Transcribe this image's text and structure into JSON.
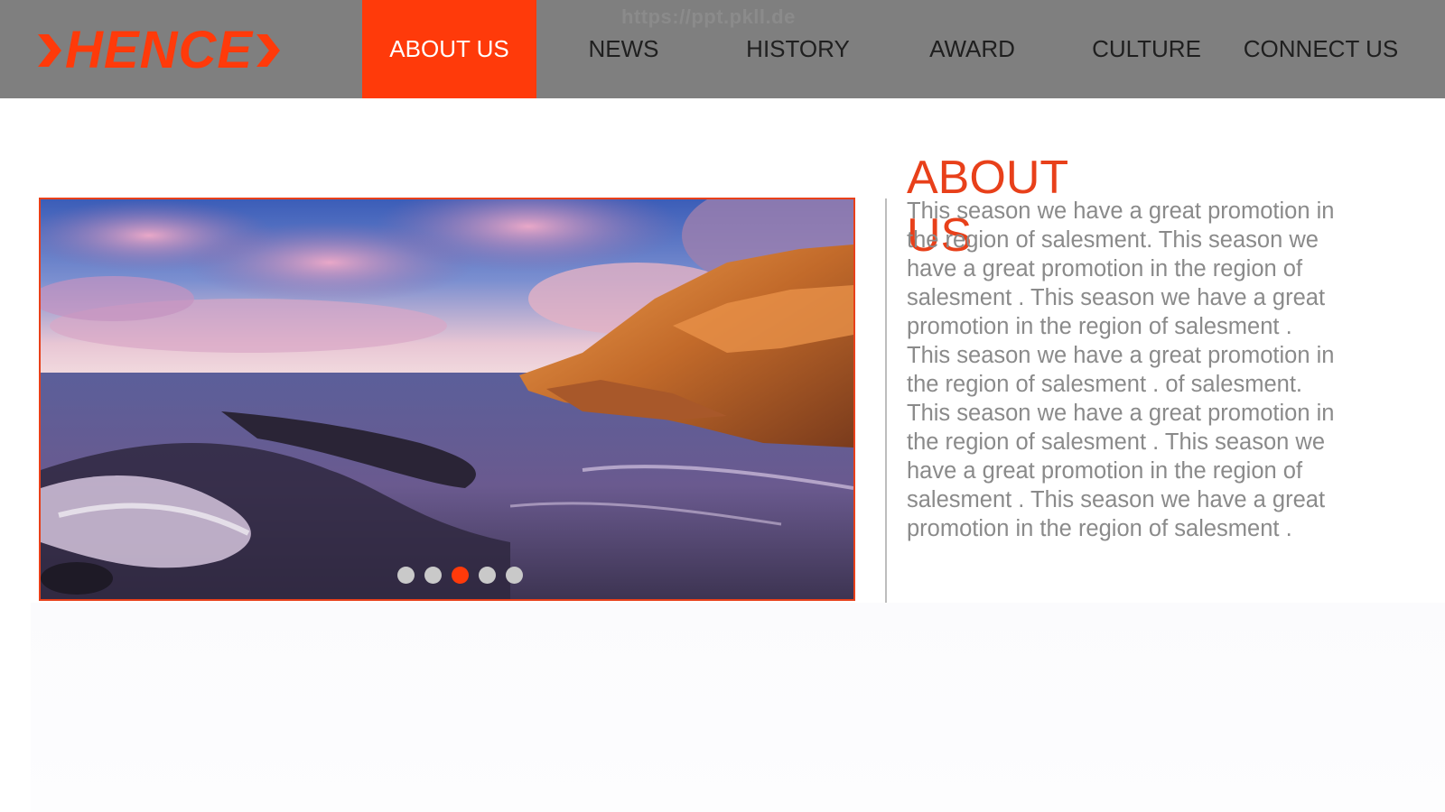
{
  "brand": {
    "name": "HENCE",
    "color": "#ff3a0a"
  },
  "watermark": "https://ppt.pkll.de",
  "nav": {
    "items": [
      {
        "label": "ABOUT US",
        "active": true
      },
      {
        "label": "NEWS",
        "active": false
      },
      {
        "label": "HISTORY",
        "active": false
      },
      {
        "label": "AWARD",
        "active": false
      },
      {
        "label": "CULTURE",
        "active": false
      },
      {
        "label": "CONNECT US",
        "active": false
      }
    ]
  },
  "slider": {
    "image": "coastal-sunset-photo",
    "dot_count": 5,
    "active_dot": 3
  },
  "about": {
    "title": "ABOUT US",
    "body": "This season we have a great promotion in the region of salesment. This season we have a great promotion in the region of salesment . This season we have a great promotion in the region of salesment . This season we have a great promotion in the region of salesment . of salesment. This season we have a great promotion in the region of salesment . This season we have a great promotion in the region of salesment . This season we have a great promotion in the region of salesment ."
  },
  "colors": {
    "navbar": "#7f7f7f",
    "accent": "#ff3a0a",
    "body_text": "#8a8a8a"
  }
}
